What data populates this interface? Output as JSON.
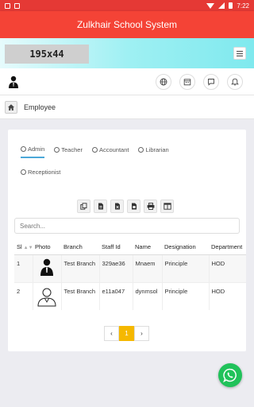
{
  "status": {
    "time": "7:22"
  },
  "app": {
    "title": "Zulkhair School System"
  },
  "logo": {
    "text": "195x44"
  },
  "breadcrumb": {
    "title": "Employee"
  },
  "tabs": [
    {
      "label": "Admin",
      "active": true
    },
    {
      "label": "Teacher"
    },
    {
      "label": "Accountant"
    },
    {
      "label": "Librarian"
    },
    {
      "label": "Receptionist"
    }
  ],
  "search": {
    "placeholder": "Search..."
  },
  "table": {
    "columns": [
      "Sl",
      "Photo",
      "Branch",
      "Staff Id",
      "Name",
      "Designation",
      "Department"
    ],
    "rows": [
      {
        "sl": "1",
        "branch": "Test Branch",
        "staff_id": "329ae36",
        "name": "Mnaem",
        "designation": "Principle",
        "department": "HOD"
      },
      {
        "sl": "2",
        "branch": "Test Branch",
        "staff_id": "e11a047",
        "name": "dynmsol",
        "designation": "Principle",
        "department": "HOD"
      }
    ]
  },
  "pagination": {
    "prev": "‹",
    "current": "1",
    "next": "›"
  },
  "colors": {
    "primary": "#f44336",
    "accent_tab": "#4aa7d8",
    "pager_active": "#f5b800",
    "whatsapp": "#20c25a"
  },
  "icons": [
    "globe-icon",
    "calendar-icon",
    "chat-icon",
    "bell-icon",
    "home-icon",
    "menu-icon",
    "whatsapp-icon",
    "copy-icon",
    "csv-icon",
    "excel-icon",
    "pdf-icon",
    "print-icon",
    "columns-icon"
  ]
}
